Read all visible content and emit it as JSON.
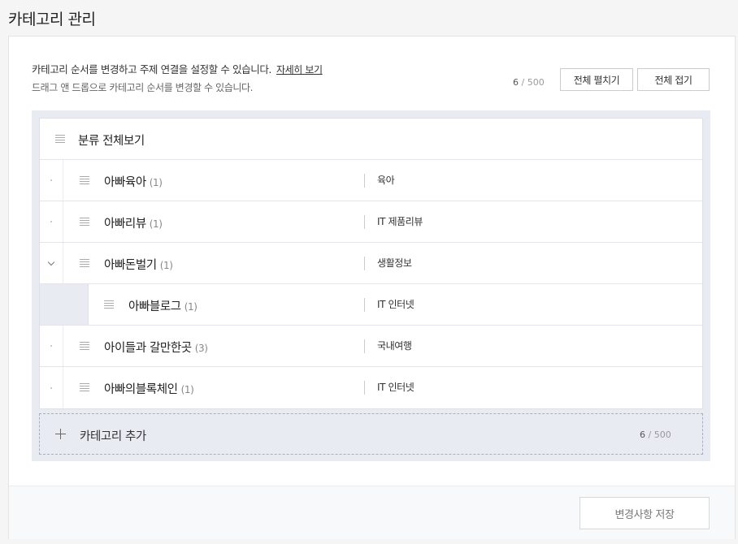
{
  "page": {
    "title": "카테고리 관리"
  },
  "description": {
    "line1": "카테고리 순서를 변경하고 주제 연결을 설정할 수 있습니다.",
    "link": "자세히 보기",
    "line2": "드래그 앤 드롭으로 카테고리 순서를 변경할 수 있습니다."
  },
  "counter": {
    "current": "6",
    "max": "/ 500"
  },
  "toolbar": {
    "expand_all": "전체 펼치기",
    "collapse_all": "전체 접기"
  },
  "tree": {
    "root_label": "분류 전체보기",
    "items": [
      {
        "name": "아빠육아",
        "count": "(1)",
        "topic": "육아"
      },
      {
        "name": "아빠리뷰",
        "count": "(1)",
        "topic": "IT 제품리뷰"
      },
      {
        "name": "아빠돈벌기",
        "count": "(1)",
        "topic": "생활정보"
      },
      {
        "name": "아빠블로그",
        "count": "(1)",
        "topic": "IT 인터넷"
      },
      {
        "name": "아이들과 갈만한곳",
        "count": "(3)",
        "topic": "국내여행"
      },
      {
        "name": "아빠의블록체인",
        "count": "(1)",
        "topic": "IT 인터넷"
      }
    ]
  },
  "add_category": {
    "label": "카테고리 추가",
    "current": "6",
    "max": "/ 500"
  },
  "footer": {
    "save_label": "변경사항 저장"
  }
}
